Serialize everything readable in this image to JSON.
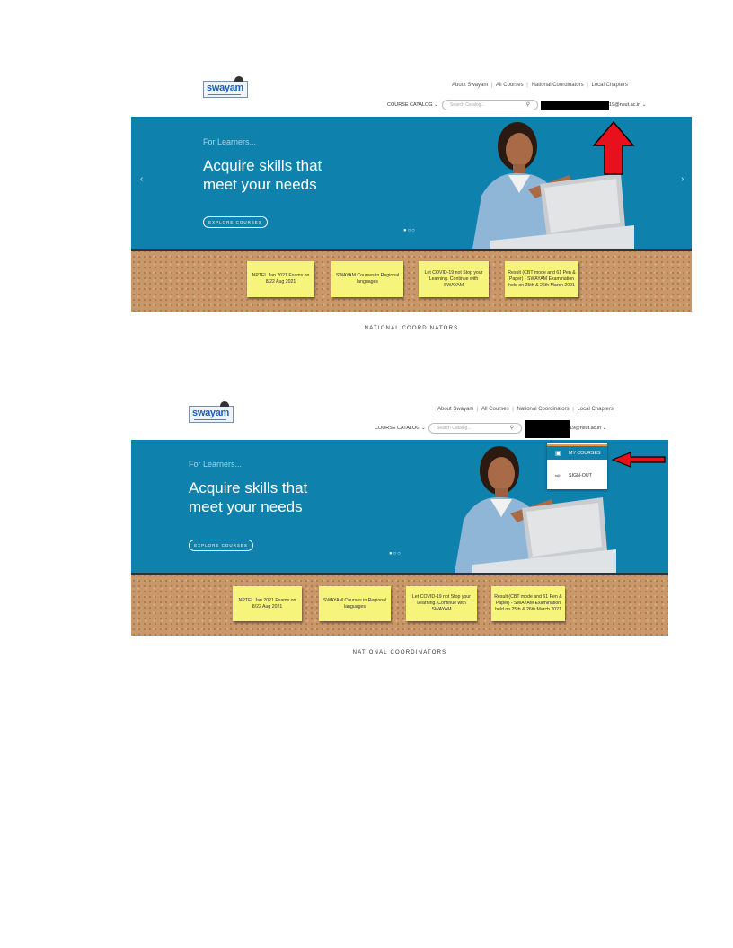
{
  "screens": [
    {
      "logo": {
        "text": "swayam"
      },
      "nav_links": [
        "About Swayam",
        "All Courses",
        "National Coordinators",
        "Local Chapters"
      ],
      "link_separator": "|",
      "course_catalog": "COURSE CATALOG",
      "chevron": "⌄",
      "search": {
        "placeholder": "Search Catalog..."
      },
      "user_email": "19@nsut.ac.in",
      "hero": {
        "kicker": "For Learners...",
        "headline": "Acquire skills that meet your needs",
        "button": "EXPLORE COURSES",
        "carousel_dots": "●○○",
        "prev_arrow": "‹",
        "next_arrow": "›"
      },
      "notes": [
        "NPTEL Jan 2021 Exams on 8/22 Aug 2021",
        "SWAYAM Courses in Regional languages",
        "Let COVID-19 not Stop your Learning. Continue with SWAYAM",
        "Result (CBT mode and 61 Pen & Paper) - SWAYAM Examination held on 25th & 26th March 2021"
      ],
      "section_title": "NATIONAL COORDINATORS"
    },
    {
      "logo": {
        "text": "swayam"
      },
      "nav_links": [
        "About Swayam",
        "All Courses",
        "National Coordinators",
        "Local Chapters"
      ],
      "link_separator": "|",
      "course_catalog": "COURSE CATALOG",
      "chevron": "⌄",
      "search": {
        "placeholder": "Search Catalog..."
      },
      "user_email": "19@nsut.ac.in",
      "hero": {
        "kicker": "For Learners...",
        "headline": "Acquire skills that meet your needs",
        "button": "EXPLORE COURSES",
        "carousel_dots": "●○○"
      },
      "dropdown": {
        "items": [
          {
            "label": "MY COURSES",
            "icon": "briefcase-icon"
          },
          {
            "label": "SIGN-OUT",
            "icon": "sign-out-icon"
          }
        ]
      },
      "notes": [
        "NPTEL Jan 2021 Exams on 8/22 Aug 2021",
        "SWAYAM Courses in Regional languages",
        "Let COVID-19 not Stop your Learning. Continue with SWAYAM",
        "Result (CBT mode and 61 Pen & Paper) - SWAYAM Examination held on 25th & 26th March 2021"
      ],
      "section_title": "NATIONAL COORDINATORS"
    }
  ],
  "colors": {
    "hero_blue": "#0f81ad",
    "sticky_note_yellow": "#f6f47a",
    "cork_board": "#c8976a",
    "callout_arrow_red": "#e8101a",
    "active_menu_accent": "#f19433"
  }
}
